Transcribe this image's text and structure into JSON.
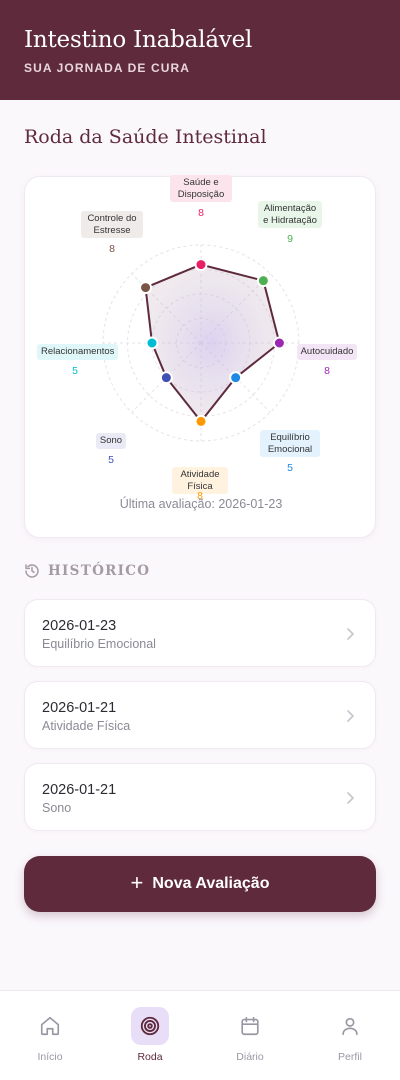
{
  "header": {
    "title": "Intestino Inabalável",
    "subtitle": "SUA JORNADA DE CURA"
  },
  "wheel": {
    "section_title": "Roda da Saúde Intestinal",
    "max_score": 10,
    "last_evaluation": "Última avaliação: 2026-01-23",
    "areas": [
      {
        "label": "Saúde e Disposição",
        "score": 8,
        "color": "#e91e63",
        "tag_bg": "#fce4ec"
      },
      {
        "label": "Alimentação e Hidratação",
        "score": 9,
        "color": "#4caf50",
        "tag_bg": "#e8f5e9"
      },
      {
        "label": "Autocuidado",
        "score": 8,
        "color": "#9c27b0",
        "tag_bg": "#f3e5f5"
      },
      {
        "label": "Equilíbrio Emocional",
        "score": 5,
        "color": "#1e88e5",
        "tag_bg": "#e3f2fd"
      },
      {
        "label": "Atividade Física",
        "score": 8,
        "color": "#ff9800",
        "tag_bg": "#fff3e0"
      },
      {
        "label": "Sono",
        "score": 5,
        "color": "#3f51b5",
        "tag_bg": "#e8eaf6"
      },
      {
        "label": "Relacionamentos",
        "score": 5,
        "color": "#00bcd4",
        "tag_bg": "#e0f7fa"
      },
      {
        "label": "Controle do Estresse",
        "score": 8,
        "color": "#795548",
        "tag_bg": "#efebe9"
      }
    ]
  },
  "history": {
    "title": "HISTÓRICO",
    "items": [
      {
        "date": "2026-01-23",
        "area": "Equilíbrio Emocional"
      },
      {
        "date": "2026-01-21",
        "area": "Atividade Física"
      },
      {
        "date": "2026-01-21",
        "area": "Sono"
      }
    ]
  },
  "cta": {
    "plus": "+",
    "label": "Nova Avaliação"
  },
  "nav": {
    "items": [
      {
        "label": "Início",
        "icon": "home-icon"
      },
      {
        "label": "Roda",
        "icon": "target-icon",
        "active": true
      },
      {
        "label": "Diário",
        "icon": "calendar-icon"
      },
      {
        "label": "Perfil",
        "icon": "user-icon"
      }
    ]
  },
  "colors": {
    "brand": "#5e2a3c",
    "background": "#fbf8fc",
    "nav_active_bg": "#e8def8"
  }
}
